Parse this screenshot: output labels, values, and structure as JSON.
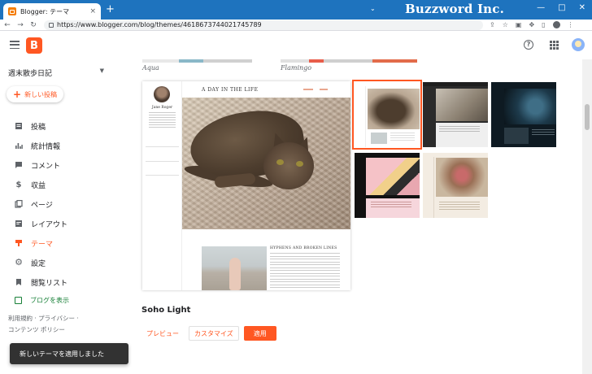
{
  "browser": {
    "tab_title": "Blogger: テーマ",
    "tab_close": "×",
    "new_tab": "+",
    "url": "https://www.blogger.com/blog/themes/4618673744021745789",
    "brand_watermark": "Buzzword Inc.",
    "controls": [
      "—",
      "□",
      "✕"
    ]
  },
  "sidebar": {
    "blog_name": "週末散歩日記",
    "new_post_label": "新しい投稿",
    "items": [
      {
        "label": "投稿",
        "icon": "posts-icon",
        "active": false
      },
      {
        "label": "統計情報",
        "icon": "stats-icon",
        "active": false
      },
      {
        "label": "コメント",
        "icon": "comments-icon",
        "active": false
      },
      {
        "label": "収益",
        "icon": "earnings-icon",
        "active": false
      },
      {
        "label": "ページ",
        "icon": "pages-icon",
        "active": false
      },
      {
        "label": "レイアウト",
        "icon": "layout-icon",
        "active": false
      },
      {
        "label": "テーマ",
        "icon": "theme-icon",
        "active": true
      },
      {
        "label": "設定",
        "icon": "settings-icon",
        "active": false
      },
      {
        "label": "閲覧リスト",
        "icon": "reading-list-icon",
        "active": false
      }
    ],
    "view_blog_label": "ブログを表示",
    "footer_links_line1": "利用規約 · プライバシー ·",
    "footer_links_line2": "コンテンツ ポリシー"
  },
  "themes": {
    "above_labels": [
      "Aqua",
      "Flamingo"
    ],
    "preview": {
      "blog_title": "A DAY IN THE LIFE",
      "author": "Jane Roger",
      "post_title": "HYPHENS AND BROKEN LINES"
    },
    "selected_theme_name": "Soho Light",
    "buttons": {
      "preview": "プレビュー",
      "customize": "カスタマイズ",
      "apply": "適用"
    }
  },
  "toast": {
    "message": "新しいテーマを適用しました"
  },
  "colors": {
    "brand": "#FF5722",
    "chrome": "#1E73BE",
    "view_blog": "#188038"
  }
}
